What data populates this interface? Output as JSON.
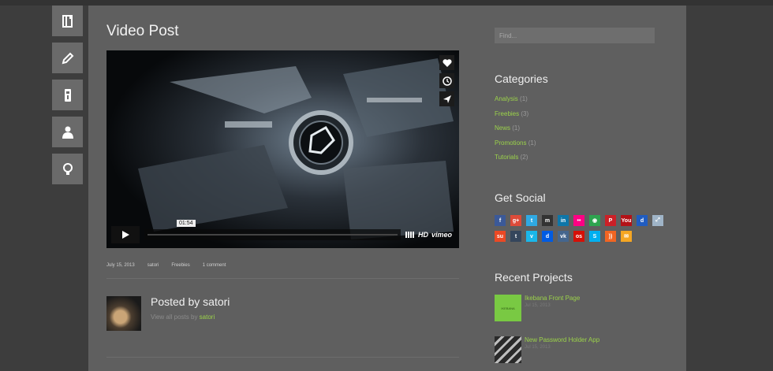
{
  "post": {
    "title": "Video Post",
    "meta": [
      "July 15, 2013",
      "satori",
      "Freebies",
      "1 comment"
    ],
    "video": {
      "time": "01:54",
      "brand": "vimeo",
      "hd": "HD"
    }
  },
  "author": {
    "heading": "Posted by satori",
    "link_prefix": "View all posts by",
    "link_name": "satori"
  },
  "sidebar": {
    "search_placeholder": "Find...",
    "categories_title": "Categories",
    "categories": [
      {
        "name": "Analysis",
        "count": "(1)"
      },
      {
        "name": "Freebies",
        "count": "(3)"
      },
      {
        "name": "News",
        "count": "(1)"
      },
      {
        "name": "Promotions",
        "count": "(1)"
      },
      {
        "name": "Tutorials",
        "count": "(2)"
      }
    ],
    "social_title": "Get Social",
    "social_row1": [
      {
        "icon": "facebook-icon",
        "glyph": "f",
        "color": "#3b5998"
      },
      {
        "icon": "google-plus-icon",
        "glyph": "g+",
        "color": "#dd4b39"
      },
      {
        "icon": "twitter-icon",
        "glyph": "t",
        "color": "#2fa9e3"
      },
      {
        "icon": "myspace-icon",
        "glyph": "m",
        "color": "#333333"
      },
      {
        "icon": "linkedin-icon",
        "glyph": "in",
        "color": "#0e76a8"
      },
      {
        "icon": "flickr-icon",
        "glyph": "••",
        "color": "#ff0084"
      },
      {
        "icon": "picasa-icon",
        "glyph": "◉",
        "color": "#2ea44f"
      },
      {
        "icon": "pinterest-icon",
        "glyph": "P",
        "color": "#cb2027"
      },
      {
        "icon": "youtube-icon",
        "glyph": "You",
        "color": "#b31217"
      },
      {
        "icon": "delicious-icon",
        "glyph": "d",
        "color": "#205cc0"
      },
      {
        "icon": "share-icon",
        "glyph": "⤢",
        "color": "#9fb4c7"
      }
    ],
    "social_row2": [
      {
        "icon": "stumbleupon-icon",
        "glyph": "su",
        "color": "#eb4924"
      },
      {
        "icon": "tumblr-icon",
        "glyph": "t",
        "color": "#35465c"
      },
      {
        "icon": "vimeo-icon",
        "glyph": "v",
        "color": "#1ab7ea"
      },
      {
        "icon": "digg-icon",
        "glyph": "d",
        "color": "#005be2"
      },
      {
        "icon": "vk-icon",
        "glyph": "vk",
        "color": "#45668e"
      },
      {
        "icon": "lastfm-icon",
        "glyph": "os",
        "color": "#d51007"
      },
      {
        "icon": "skype-icon",
        "glyph": "S",
        "color": "#00aff0"
      },
      {
        "icon": "rss-icon",
        "glyph": "))",
        "color": "#f26522"
      },
      {
        "icon": "email-icon",
        "glyph": "✉",
        "color": "#f5a623"
      }
    ],
    "projects_title": "Recent Projects",
    "projects": [
      {
        "title": "Ikebana Front Page",
        "date": "Jul 15, 2013",
        "thumb_label": "IKEBANA",
        "thumb_color": "#79c943"
      },
      {
        "title": "New Password Holder App",
        "date": "Jul 15, 2013",
        "thumb_label": "",
        "thumb_color": "#2a2a2a"
      }
    ]
  },
  "colors": {
    "accent": "#9bd24a",
    "panel": "#5f5f5f",
    "background": "#3d3d3d"
  }
}
